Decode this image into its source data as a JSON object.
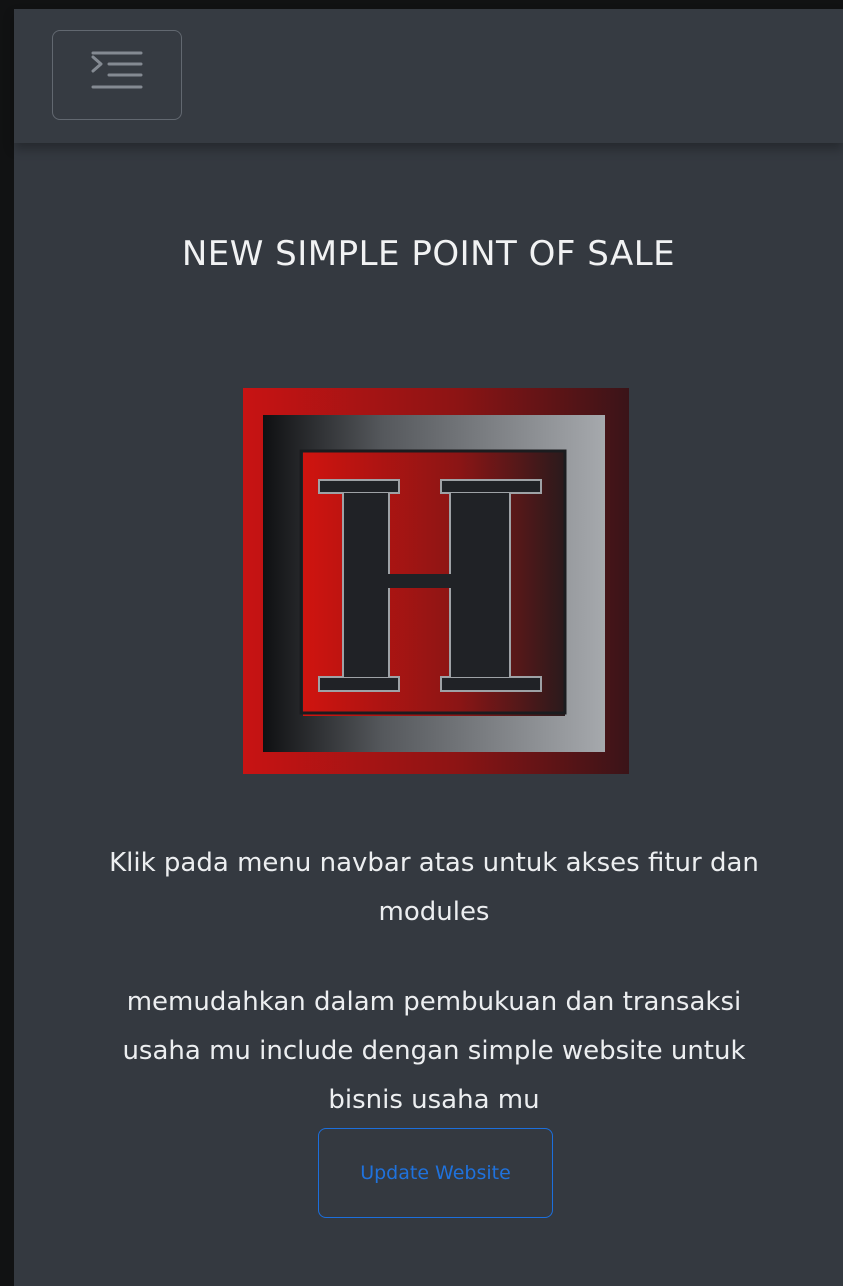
{
  "navbar": {
    "toggle_icon": "menu-indent-icon"
  },
  "main": {
    "title": "NEW SIMPLE POINT OF SALE",
    "logo": {
      "letter": "H",
      "icon": "h-logo-icon",
      "colors": {
        "red": "#c41212",
        "dark": "#1e2024",
        "grey": "#9a9ea3"
      }
    },
    "description_1": "Klik pada menu navbar atas untuk akses fitur dan modules",
    "description_2": "memudahkan dalam pembukuan dan transaksi usaha mu include dengan simple website untuk bisnis usaha mu",
    "update_button_label": "Update Website"
  },
  "colors": {
    "background": "#343940",
    "accent": "#1f72dd"
  }
}
